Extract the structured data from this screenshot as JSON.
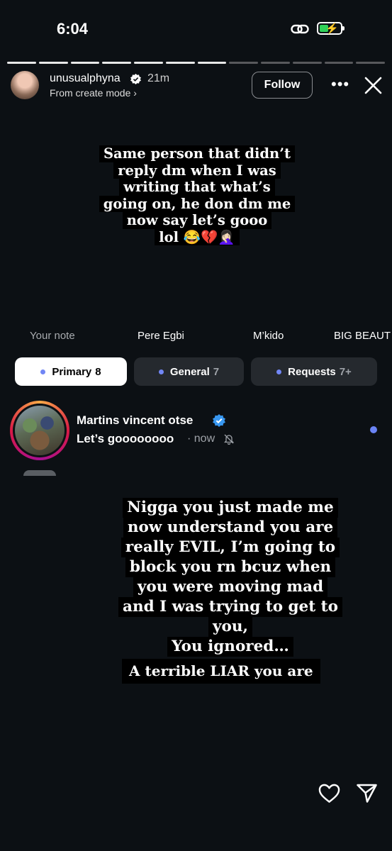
{
  "status_bar": {
    "time": "6:04",
    "link_icon": "link-icon",
    "battery_icon": "battery-charging-icon",
    "battery_color": "#30d158"
  },
  "story": {
    "progress": {
      "segments": 12,
      "completed": 7
    },
    "username": "unusualphyna",
    "verified": true,
    "age": "21m",
    "subline": "From create mode ›",
    "follow_label": "Follow",
    "more_label": "•••",
    "close_icon": "close-icon"
  },
  "captions": {
    "top_lines": [
      "Same person that didn’t",
      "reply dm when I was",
      "writing that what’s",
      "going on, he don dm me",
      "now say let’s gooo",
      "lol 😂💔🤦🏻‍♀️"
    ],
    "middle_lines": [
      "Nigga you just made me",
      "now understand you are",
      "really EVIL, I’m going to",
      "block you rn bcuz when",
      "you were moving mad",
      "and I was trying to get to",
      "you,",
      "You ignored…"
    ],
    "bottom_line": "A terrible LIAR you are"
  },
  "notes": [
    "Your note",
    "Pere Egbi",
    "M’kido",
    "BIG BEAUT"
  ],
  "tabs": [
    {
      "label": "Primary",
      "count": "8"
    },
    {
      "label": "General",
      "count": "7"
    },
    {
      "label": "Requests",
      "count": "7+"
    }
  ],
  "accent_color": "#7186f5",
  "dm": {
    "name": "Martins vincent otse",
    "verified": true,
    "message": "Let’s goooooooo",
    "time": "· now",
    "mute_icon": "bell-slash-icon",
    "unread": true
  },
  "actions": {
    "like_icon": "heart-icon",
    "share_icon": "send-icon"
  }
}
